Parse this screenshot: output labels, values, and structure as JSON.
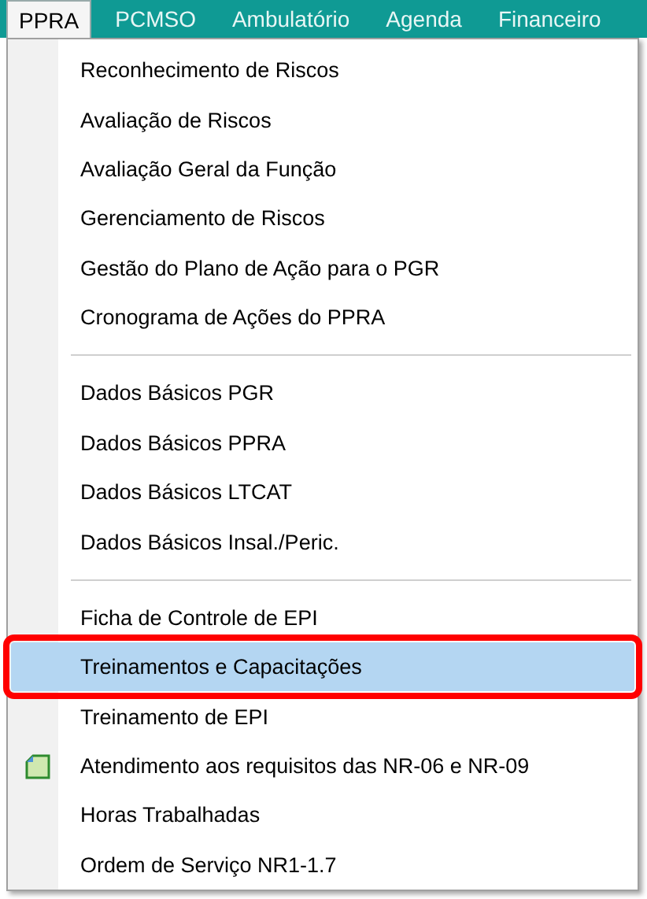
{
  "menubar": [
    {
      "label": "PPRA",
      "selected": true
    },
    {
      "label": "PCMSO",
      "selected": false
    },
    {
      "label": "Ambulatório",
      "selected": false
    },
    {
      "label": "Agenda",
      "selected": false
    },
    {
      "label": "Financeiro",
      "selected": false
    }
  ],
  "menu": {
    "groups": [
      [
        {
          "label": "Reconhecimento de Riscos",
          "selected": false,
          "kind": "plain"
        },
        {
          "label": "Avaliação de Riscos",
          "selected": false,
          "kind": "plain"
        },
        {
          "label": "Avaliação Geral da Função",
          "selected": false,
          "kind": "plain"
        },
        {
          "label": "Gerenciamento de Riscos",
          "selected": false,
          "kind": "plain"
        },
        {
          "label": "Gestão do Plano de Ação para o PGR",
          "selected": false,
          "kind": "plain"
        },
        {
          "label": "Cronograma de Ações do PPRA",
          "selected": false,
          "kind": "plain"
        }
      ],
      [
        {
          "label": "Dados Básicos PGR",
          "selected": false,
          "kind": "plain"
        },
        {
          "label": "Dados Básicos PPRA",
          "selected": false,
          "kind": "plain"
        },
        {
          "label": "Dados Básicos LTCAT",
          "selected": false,
          "kind": "plain"
        },
        {
          "label": "Dados Básicos Insal./Peric.",
          "selected": false,
          "kind": "plain"
        }
      ],
      [
        {
          "label": "Ficha de Controle de EPI",
          "selected": false,
          "kind": "plain"
        },
        {
          "label": "Treinamentos e Capacitações",
          "selected": true,
          "kind": "plain"
        },
        {
          "label": "Treinamento de EPI",
          "selected": false,
          "kind": "plain"
        },
        {
          "label": "Atendimento aos requisitos das NR-06 e NR-09",
          "selected": false,
          "kind": "icon"
        },
        {
          "label": "Horas Trabalhadas",
          "selected": false,
          "kind": "plain"
        },
        {
          "label": "Ordem de Serviço NR1-1.7",
          "selected": false,
          "kind": "plain"
        }
      ]
    ]
  }
}
